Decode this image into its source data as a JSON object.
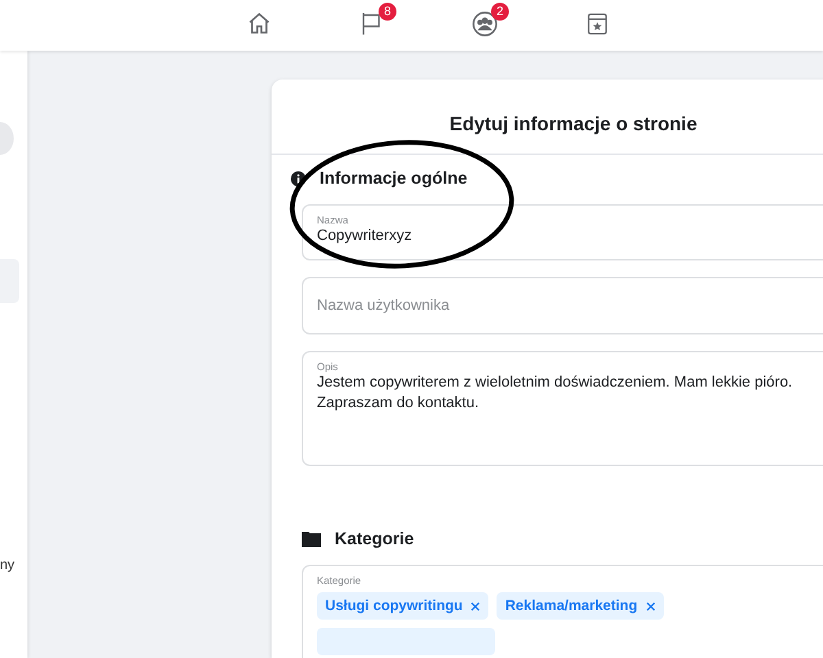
{
  "top_nav": [
    {
      "kind": "home",
      "selected": false
    },
    {
      "kind": "flag",
      "badge": "8",
      "selected": false
    },
    {
      "kind": "groups",
      "badge": "2",
      "selected": false
    },
    {
      "kind": "calendar",
      "selected": false
    }
  ],
  "sidebar": {
    "fragment_text": "ny"
  },
  "card": {
    "title": "Edytuj informacje o stronie",
    "sections": [
      {
        "kind": "info",
        "heading": "Informacje ogólne",
        "fields": [
          {
            "kind": "input",
            "label": "Nazwa",
            "value": "Copywriterxyz"
          },
          {
            "kind": "input",
            "placeholder": "Nazwa użytkownika"
          },
          {
            "kind": "textarea",
            "label": "Opis",
            "value": "Jestem copywriterem z wieloletnim doświadczeniem. Mam lekkie pióro. Zapraszam do kontaktu."
          }
        ]
      },
      {
        "kind": "categories",
        "heading": "Kategorie",
        "fields": [
          {
            "kind": "chips",
            "label": "Kategorie",
            "chips": [
              "Usługi copywritingu",
              "Reklama/marketing"
            ],
            "more_chips_cut_off": true
          }
        ]
      }
    ]
  }
}
